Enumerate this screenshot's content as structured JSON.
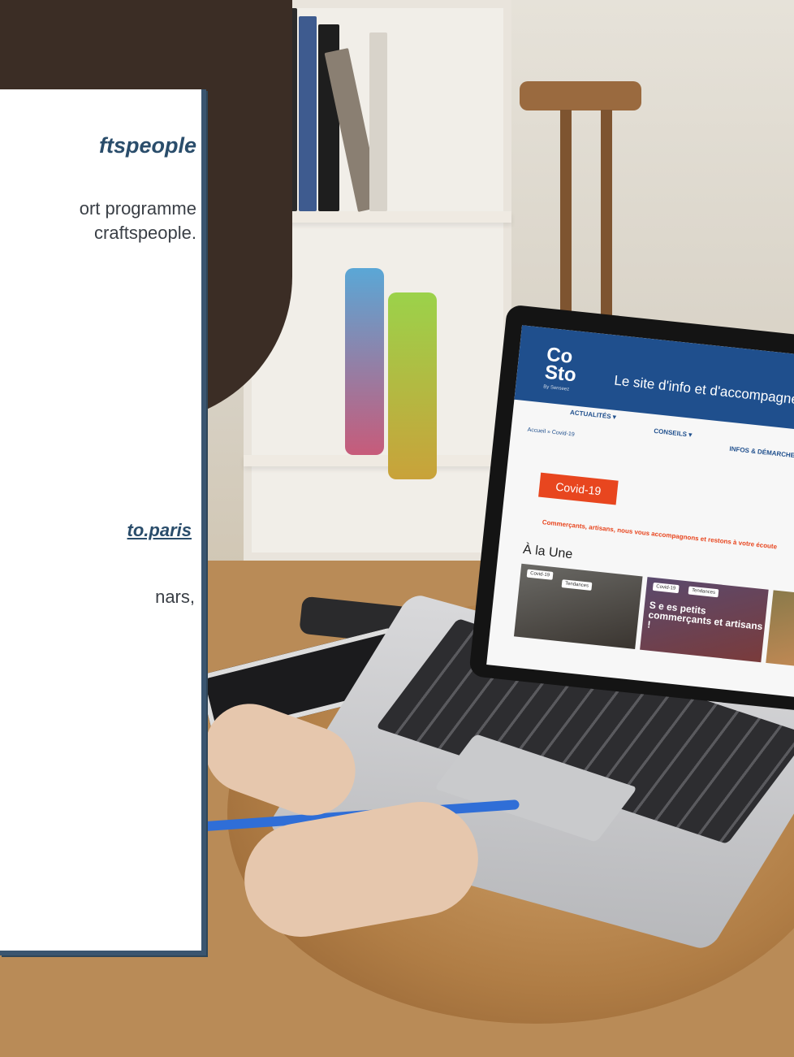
{
  "panel": {
    "title": "ftspeople",
    "body_line1": "ort programme",
    "body_line2": "craftspeople.",
    "link": "to.paris",
    "extra": "nars,"
  },
  "screen": {
    "logo_line1": "Co",
    "logo_line2": "Sto",
    "logo_sub": "By Senseez",
    "tagline": "Le site d'info et d'accompagnemen",
    "nav": [
      "ACTUALITÉS ▾",
      "CONSEILS ▾",
      "INFOS & DÉMARCHES ▾"
    ],
    "breadcrumb": "Accueil » Covid-19",
    "tag": "Covid-19",
    "hero": "Commerçants, artisans, nous vous accompagnons et restons à votre écoute",
    "section": "À la Une",
    "cards": [
      {
        "pill1": "Covid-19",
        "pill2": "Tendances",
        "title": ""
      },
      {
        "pill1": "Covid-19",
        "pill2": "Tendances",
        "title": "S   e   es petits commerçants et artisans !"
      }
    ]
  },
  "colors": {
    "panel_border": "#3a5570",
    "title": "#2a4d6b",
    "site_blue": "#1f4f8d",
    "site_orange": "#e8461f"
  }
}
